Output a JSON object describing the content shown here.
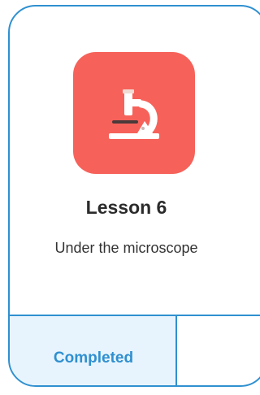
{
  "lesson": {
    "title": "Lesson 6",
    "subtitle": "Under the microscope",
    "icon": "microscope-icon",
    "status_label": "Completed"
  },
  "colors": {
    "accent": "#2f90d0",
    "icon_tile": "#f6625a",
    "status_background": "#e8f4fd"
  }
}
